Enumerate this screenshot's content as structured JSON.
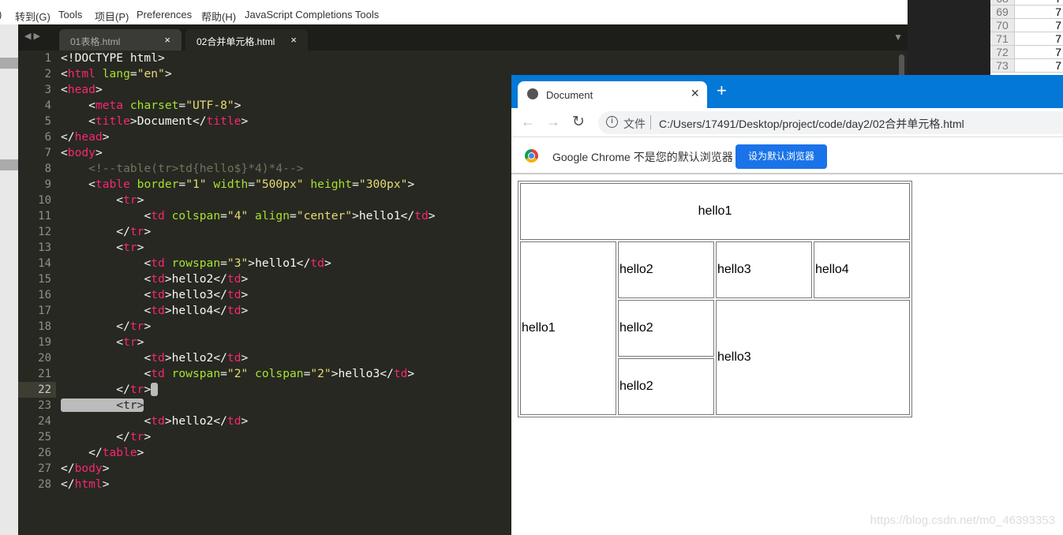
{
  "menu": [
    ")",
    "转到(G)",
    "Tools",
    "项目(P)",
    "Preferences",
    "帮助(H)",
    "JavaScript Completions Tools"
  ],
  "editor": {
    "tabs": [
      {
        "label": "01表格.html",
        "active": false
      },
      {
        "label": "02合并单元格.html",
        "active": true
      }
    ],
    "current_line": 22,
    "lines": [
      [
        [
          "p",
          "<!DOCTYPE html>"
        ]
      ],
      [
        [
          "p",
          "<"
        ],
        [
          "t",
          "html"
        ],
        [
          "a",
          " lang"
        ],
        [
          "p",
          "="
        ],
        [
          "s",
          "\"en\""
        ],
        [
          "p",
          ">"
        ]
      ],
      [
        [
          "p",
          "<"
        ],
        [
          "t",
          "head"
        ],
        [
          "p",
          ">"
        ]
      ],
      [
        [
          "x",
          "    "
        ],
        [
          "p",
          "<"
        ],
        [
          "t",
          "meta"
        ],
        [
          "a",
          " charset"
        ],
        [
          "p",
          "="
        ],
        [
          "s",
          "\"UTF-8\""
        ],
        [
          "p",
          ">"
        ]
      ],
      [
        [
          "x",
          "    "
        ],
        [
          "p",
          "<"
        ],
        [
          "t",
          "title"
        ],
        [
          "p",
          ">"
        ],
        [
          "x",
          "Document"
        ],
        [
          "p",
          "</"
        ],
        [
          "t",
          "title"
        ],
        [
          "p",
          ">"
        ]
      ],
      [
        [
          "p",
          "</"
        ],
        [
          "t",
          "head"
        ],
        [
          "p",
          ">"
        ]
      ],
      [
        [
          "p",
          "<"
        ],
        [
          "t",
          "body"
        ],
        [
          "p",
          ">"
        ]
      ],
      [
        [
          "x",
          "    "
        ],
        [
          "c",
          "<!--table(tr>td{hello$}*4)*4-->"
        ]
      ],
      [
        [
          "x",
          "    "
        ],
        [
          "p",
          "<"
        ],
        [
          "t",
          "table"
        ],
        [
          "a",
          " border"
        ],
        [
          "p",
          "="
        ],
        [
          "s",
          "\"1\""
        ],
        [
          "a",
          " width"
        ],
        [
          "p",
          "="
        ],
        [
          "s",
          "\"500px\""
        ],
        [
          "a",
          " height"
        ],
        [
          "p",
          "="
        ],
        [
          "s",
          "\"300px\""
        ],
        [
          "p",
          ">"
        ]
      ],
      [
        [
          "x",
          "        "
        ],
        [
          "p",
          "<"
        ],
        [
          "t",
          "tr"
        ],
        [
          "p",
          ">"
        ]
      ],
      [
        [
          "x",
          "            "
        ],
        [
          "p",
          "<"
        ],
        [
          "t",
          "td"
        ],
        [
          "a",
          " colspan"
        ],
        [
          "p",
          "="
        ],
        [
          "s",
          "\"4\""
        ],
        [
          "a",
          " align"
        ],
        [
          "p",
          "="
        ],
        [
          "s",
          "\"center\""
        ],
        [
          "p",
          ">"
        ],
        [
          "x",
          "hello1"
        ],
        [
          "p",
          "</"
        ],
        [
          "t",
          "td"
        ],
        [
          "p",
          ">"
        ]
      ],
      [
        [
          "x",
          "        "
        ],
        [
          "p",
          "</"
        ],
        [
          "t",
          "tr"
        ],
        [
          "p",
          ">"
        ]
      ],
      [
        [
          "x",
          "        "
        ],
        [
          "p",
          "<"
        ],
        [
          "t",
          "tr"
        ],
        [
          "p",
          ">"
        ]
      ],
      [
        [
          "x",
          "            "
        ],
        [
          "p",
          "<"
        ],
        [
          "t",
          "td"
        ],
        [
          "a",
          " rowspan"
        ],
        [
          "p",
          "="
        ],
        [
          "s",
          "\"3\""
        ],
        [
          "p",
          ">"
        ],
        [
          "x",
          "hello1"
        ],
        [
          "p",
          "</"
        ],
        [
          "t",
          "td"
        ],
        [
          "p",
          ">"
        ]
      ],
      [
        [
          "x",
          "            "
        ],
        [
          "p",
          "<"
        ],
        [
          "t",
          "td"
        ],
        [
          "p",
          ">"
        ],
        [
          "x",
          "hello2"
        ],
        [
          "p",
          "</"
        ],
        [
          "t",
          "td"
        ],
        [
          "p",
          ">"
        ]
      ],
      [
        [
          "x",
          "            "
        ],
        [
          "p",
          "<"
        ],
        [
          "t",
          "td"
        ],
        [
          "p",
          ">"
        ],
        [
          "x",
          "hello3"
        ],
        [
          "p",
          "</"
        ],
        [
          "t",
          "td"
        ],
        [
          "p",
          ">"
        ]
      ],
      [
        [
          "x",
          "            "
        ],
        [
          "p",
          "<"
        ],
        [
          "t",
          "td"
        ],
        [
          "p",
          ">"
        ],
        [
          "x",
          "hello4"
        ],
        [
          "p",
          "</"
        ],
        [
          "t",
          "td"
        ],
        [
          "p",
          ">"
        ]
      ],
      [
        [
          "x",
          "        "
        ],
        [
          "p",
          "</"
        ],
        [
          "t",
          "tr"
        ],
        [
          "p",
          ">"
        ]
      ],
      [
        [
          "x",
          "        "
        ],
        [
          "p",
          "<"
        ],
        [
          "t",
          "tr"
        ],
        [
          "p",
          ">"
        ]
      ],
      [
        [
          "x",
          "            "
        ],
        [
          "p",
          "<"
        ],
        [
          "t",
          "td"
        ],
        [
          "p",
          ">"
        ],
        [
          "x",
          "hello2"
        ],
        [
          "p",
          "</"
        ],
        [
          "t",
          "td"
        ],
        [
          "p",
          ">"
        ]
      ],
      [
        [
          "x",
          "            "
        ],
        [
          "p",
          "<"
        ],
        [
          "t",
          "td"
        ],
        [
          "a",
          " rowspan"
        ],
        [
          "p",
          "="
        ],
        [
          "s",
          "\"2\""
        ],
        [
          "a",
          " colspan"
        ],
        [
          "p",
          "="
        ],
        [
          "s",
          "\"2\""
        ],
        [
          "p",
          ">"
        ],
        [
          "x",
          "hello3"
        ],
        [
          "p",
          "</"
        ],
        [
          "t",
          "td"
        ],
        [
          "p",
          ">"
        ]
      ],
      [
        [
          "x",
          "        "
        ],
        [
          "p",
          "</"
        ],
        [
          "t",
          "tr"
        ],
        [
          "p",
          ">"
        ],
        [
          "sel",
          " "
        ]
      ],
      [
        [
          "sel",
          "        <tr>"
        ]
      ],
      [
        [
          "x",
          "            "
        ],
        [
          "p",
          "<"
        ],
        [
          "t",
          "td"
        ],
        [
          "p",
          ">"
        ],
        [
          "x",
          "hello2"
        ],
        [
          "p",
          "</"
        ],
        [
          "t",
          "td"
        ],
        [
          "p",
          ">"
        ]
      ],
      [
        [
          "x",
          "        "
        ],
        [
          "p",
          "</"
        ],
        [
          "t",
          "tr"
        ],
        [
          "p",
          ">"
        ]
      ],
      [
        [
          "x",
          "    "
        ],
        [
          "p",
          "</"
        ],
        [
          "t",
          "table"
        ],
        [
          "p",
          ">"
        ]
      ],
      [
        [
          "p",
          "</"
        ],
        [
          "t",
          "body"
        ],
        [
          "p",
          ">"
        ]
      ],
      [
        [
          "p",
          "</"
        ],
        [
          "t",
          "html"
        ],
        [
          "p",
          ">"
        ]
      ]
    ]
  },
  "sheet": {
    "rows": [
      [
        "68",
        "7"
      ],
      [
        "69",
        "7"
      ],
      [
        "70",
        "7"
      ],
      [
        "71",
        "7"
      ],
      [
        "72",
        "7"
      ],
      [
        "73",
        "7"
      ]
    ]
  },
  "browser": {
    "tab_title": "Document",
    "new_tab": "+",
    "close": "×",
    "security_label": "文件",
    "url": "C:/Users/17491/Desktop/project/code/day2/02合并单元格.html",
    "infobar_text": "Google Chrome 不是您的默认浏览器",
    "set_default_button": "设为默认浏览器",
    "accent": "#0478d7"
  },
  "table": {
    "r1": "hello1",
    "r2c1": "hello1",
    "r2c2": "hello2",
    "r2c3": "hello3",
    "r2c4": "hello4",
    "r3c2": "hello2",
    "r3c3": "hello3",
    "r4c2": "hello2"
  },
  "watermark": "https://blog.csdn.net/m0_46393353"
}
